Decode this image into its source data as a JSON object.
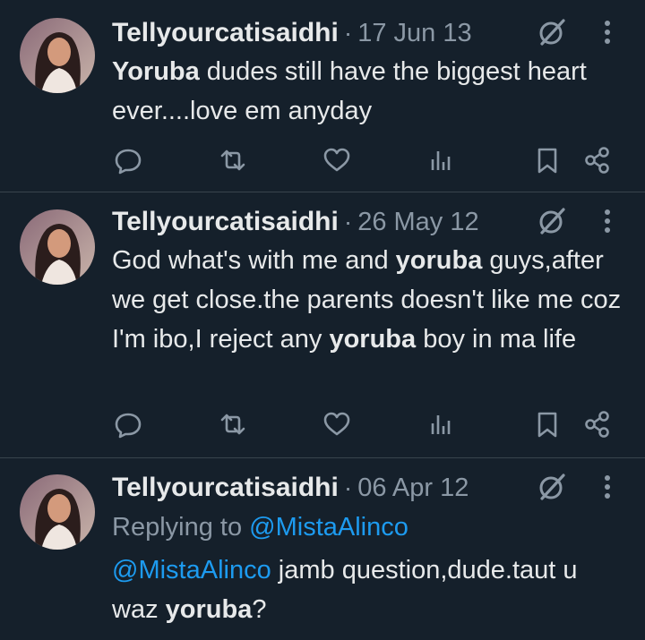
{
  "colors": {
    "bg": "#15202b",
    "text": "#e7e9ea",
    "muted": "#8b98a5",
    "link": "#1d9bf0",
    "divider": "#38444d"
  },
  "tweets": [
    {
      "author": "Tellyourcatisaidhi",
      "separator": "·",
      "date": "17 Jun 13",
      "segments": [
        {
          "t": "Yoruba",
          "s": "bold"
        },
        {
          "t": " dudes still have the biggest heart ever....love em anyday",
          "s": "normal"
        }
      ]
    },
    {
      "author": "Tellyourcatisaidhi",
      "separator": "·",
      "date": "26 May 12",
      "segments": [
        {
          "t": "God what's with me and ",
          "s": "normal"
        },
        {
          "t": "yoruba",
          "s": "bold"
        },
        {
          "t": " guys,after we get close.the parents doesn't like me coz I'm ibo,I reject any ",
          "s": "normal"
        },
        {
          "t": "yoruba",
          "s": "bold"
        },
        {
          "t": " boy in ma life",
          "s": "normal"
        }
      ]
    },
    {
      "author": "Tellyourcatisaidhi",
      "separator": "·",
      "date": "06 Apr 12",
      "replying_prefix": "Replying to ",
      "replying_handle": "@MistaAlinco",
      "segments": [
        {
          "t": "@MistaAlinco",
          "s": "link"
        },
        {
          "t": " jamb question,dude.taut u  waz ",
          "s": "normal"
        },
        {
          "t": "yoruba",
          "s": "bold"
        },
        {
          "t": "?",
          "s": "normal"
        }
      ]
    }
  ],
  "icons": [
    "grok-icon",
    "more-icon",
    "reply-icon",
    "retweet-icon",
    "like-icon",
    "views-icon",
    "bookmark-icon",
    "share-icon"
  ]
}
